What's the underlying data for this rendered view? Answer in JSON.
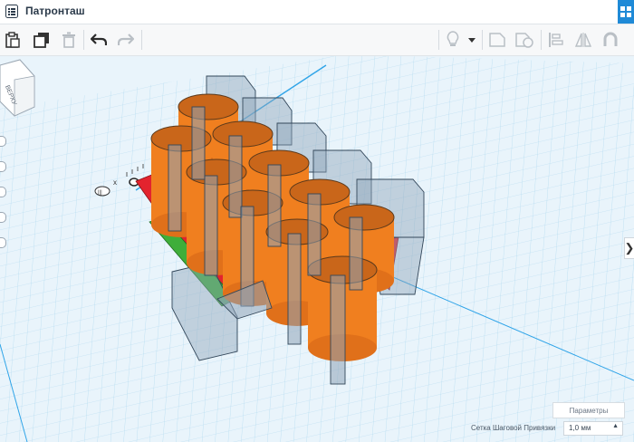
{
  "window": {
    "title": "Патронташ",
    "icon": "document-list-icon",
    "apps_icon": "apps-grid-icon"
  },
  "toolbar": {
    "buttons": [
      {
        "name": "copy-button",
        "icon": "clipboard-icon"
      },
      {
        "name": "duplicate-button",
        "icon": "duplicate-icon"
      },
      {
        "name": "delete-button",
        "icon": "trash-icon"
      },
      {
        "name": "undo-button",
        "icon": "undo-arrow-icon"
      },
      {
        "name": "redo-button",
        "icon": "redo-arrow-icon"
      },
      {
        "name": "light-button",
        "icon": "lightbulb-icon"
      },
      {
        "name": "light-dropdown",
        "icon": "caret-down-icon"
      },
      {
        "name": "shape-button",
        "icon": "shape-icon"
      },
      {
        "name": "hole-button",
        "icon": "hole-icon"
      },
      {
        "name": "align-button",
        "icon": "align-icon"
      },
      {
        "name": "mirror-button",
        "icon": "mirror-icon"
      },
      {
        "name": "magnet-button",
        "icon": "magnet-icon"
      }
    ]
  },
  "viewcube": {
    "face_label": "ВЕРХУ"
  },
  "workplane": {
    "ruler_x_label": "x",
    "colors": {
      "grid": "#a9d6ef",
      "solid": "#f07f1f",
      "hole": "#8fa4b8",
      "red": "#e3232e",
      "green": "#3fae3a",
      "axis": "#2fa4e8"
    }
  },
  "footer": {
    "params_label": "Параметры",
    "snap_label": "Сетка Шаговой Привязки",
    "snap_value": "1,0 мм"
  },
  "panel_toggle": "❯"
}
